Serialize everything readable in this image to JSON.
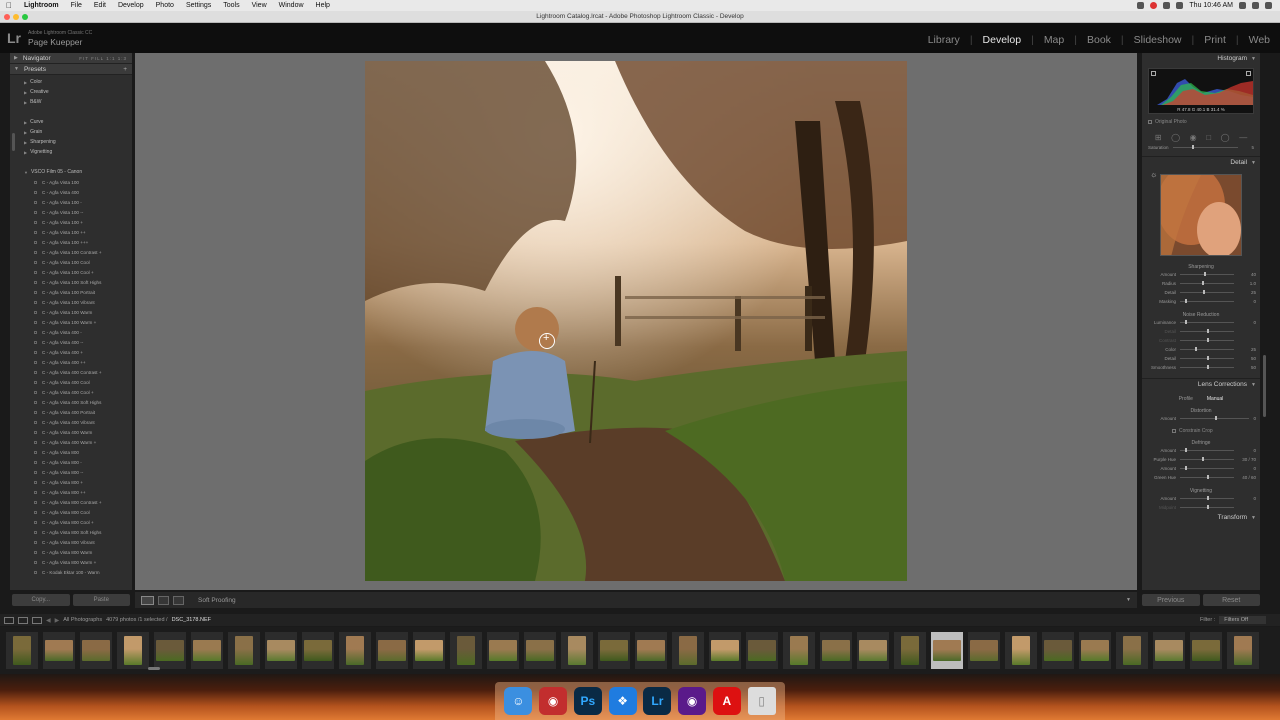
{
  "menubar": {
    "apple_icon": "apple-icon",
    "items": [
      "Lightroom",
      "File",
      "Edit",
      "Develop",
      "Photo",
      "Settings",
      "Tools",
      "View",
      "Window",
      "Help"
    ],
    "clock": "Thu 10:46 AM"
  },
  "window": {
    "title": "Lightroom Catalog.lrcat - Adobe Photoshop Lightroom Classic - Develop"
  },
  "identity": {
    "logo": "Lr",
    "app_name": "Adobe Lightroom Classic CC",
    "user": "Page Kuepper"
  },
  "modules": {
    "items": [
      "Library",
      "Develop",
      "Map",
      "Book",
      "Slideshow",
      "Print",
      "Web"
    ],
    "active": "Develop"
  },
  "left_panel": {
    "navigator_label": "Navigator",
    "navigator_zoom": "FIT",
    "navigator_extras": "FILL 1:1 1:3",
    "presets_label": "Presets",
    "group_a": [
      "Color",
      "Creative",
      "B&W"
    ],
    "group_b": [
      "Curve",
      "Grain",
      "Sharpening",
      "Vignetting"
    ],
    "vsco_group": "VSCO Film 05 - Canon",
    "vsco_items": [
      "C - Agfa Vista 100",
      "C - Agfa Vista 400",
      "C - Agfa Vista 100 -",
      "C - Agfa Vista 100 --",
      "C - Agfa Vista 100 +",
      "C - Agfa Vista 100 ++",
      "C - Agfa Vista 100 +++",
      "C - Agfa Vista 100 Contrast +",
      "C - Agfa Vista 100 Cool",
      "C - Agfa Vista 100 Cool +",
      "C - Agfa Vista 100 Soft Highs",
      "C - Agfa Vista 100 Portrait",
      "C - Agfa Vista 100 Vibrant",
      "C - Agfa Vista 100 Warm",
      "C - Agfa Vista 100 Warm +",
      "C - Agfa Vista 400 -",
      "C - Agfa Vista 400 --",
      "C - Agfa Vista 400 +",
      "C - Agfa Vista 400 ++",
      "C - Agfa Vista 400 Contrast +",
      "C - Agfa Vista 400 Cool",
      "C - Agfa Vista 400 Cool +",
      "C - Agfa Vista 400 Soft Highs",
      "C - Agfa Vista 400 Portrait",
      "C - Agfa Vista 400 Vibrant",
      "C - Agfa Vista 400 Warm",
      "C - Agfa Vista 400 Warm +",
      "C - Agfa Vista 800",
      "C - Agfa Vista 800 -",
      "C - Agfa Vista 800 --",
      "C - Agfa Vista 800 +",
      "C - Agfa Vista 800 ++",
      "C - Agfa Vista 800 Contrast +",
      "C - Agfa Vista 800 Cool",
      "C - Agfa Vista 800 Cool +",
      "C - Agfa Vista 800 Soft Highs",
      "C - Agfa Vista 800 Vibrant",
      "C - Agfa Vista 800 Warm",
      "C - Agfa Vista 800 Warm +",
      "C - Kodak Ektar 100 - Warm"
    ],
    "copy_button": "Copy...",
    "paste_button": "Paste"
  },
  "toolbar": {
    "soft_proofing": "Soft Proofing"
  },
  "right_panel": {
    "histogram_label": "Histogram",
    "histogram_readout": "R 47.8  G 40.1  B 31.4 %",
    "original_photo": "Original Photo",
    "saturation_label": "Saturation",
    "saturation_value": "5",
    "detail_label": "Detail",
    "sharpening_label": "Sharpening",
    "sharpening_rows": [
      {
        "name": "Amount",
        "value": "40"
      },
      {
        "name": "Radius",
        "value": "1.0"
      },
      {
        "name": "Detail",
        "value": "25"
      },
      {
        "name": "Masking",
        "value": "0"
      }
    ],
    "noise_label": "Noise Reduction",
    "noise_rows": [
      {
        "name": "Luminance",
        "value": "0"
      },
      {
        "name": "Detail",
        "value": ""
      },
      {
        "name": "Contrast",
        "value": ""
      }
    ],
    "color_rows": [
      {
        "name": "Color",
        "value": "25"
      },
      {
        "name": "Detail",
        "value": "50"
      },
      {
        "name": "Smoothness",
        "value": "50"
      }
    ],
    "lens_label": "Lens Corrections",
    "lens_tabs": [
      "Profile",
      "Manual"
    ],
    "lens_active_tab": "Manual",
    "distortion_label": "Distortion",
    "distortion_amount": {
      "name": "Amount",
      "value": "0"
    },
    "constrain_crop": "Constrain Crop",
    "defringe_label": "Defringe",
    "defringe_rows": [
      {
        "name": "Amount",
        "value": "0"
      },
      {
        "name": "Purple Hue",
        "value": "30 / 70"
      },
      {
        "name": "Amount",
        "value": "0"
      },
      {
        "name": "Green Hue",
        "value": "40 / 60"
      }
    ],
    "vignetting_label": "Vignetting",
    "vignetting_rows": [
      {
        "name": "Amount",
        "value": "0"
      },
      {
        "name": "Midpoint",
        "value": ""
      }
    ],
    "transform_label": "Transform",
    "previous_button": "Previous",
    "reset_button": "Reset"
  },
  "filmstrip": {
    "source": "All Photographs",
    "count": "4079 photos /1 selected /",
    "filename": "DSC_3178.NEF",
    "filter_label": "Filter :",
    "filter_value": "Filters Off"
  },
  "dock": {
    "apps": [
      "Finder",
      "Photo Booth",
      "Ps",
      "Safari",
      "Lr",
      "Premiere Rush",
      "Acrobat",
      "Trash"
    ]
  }
}
